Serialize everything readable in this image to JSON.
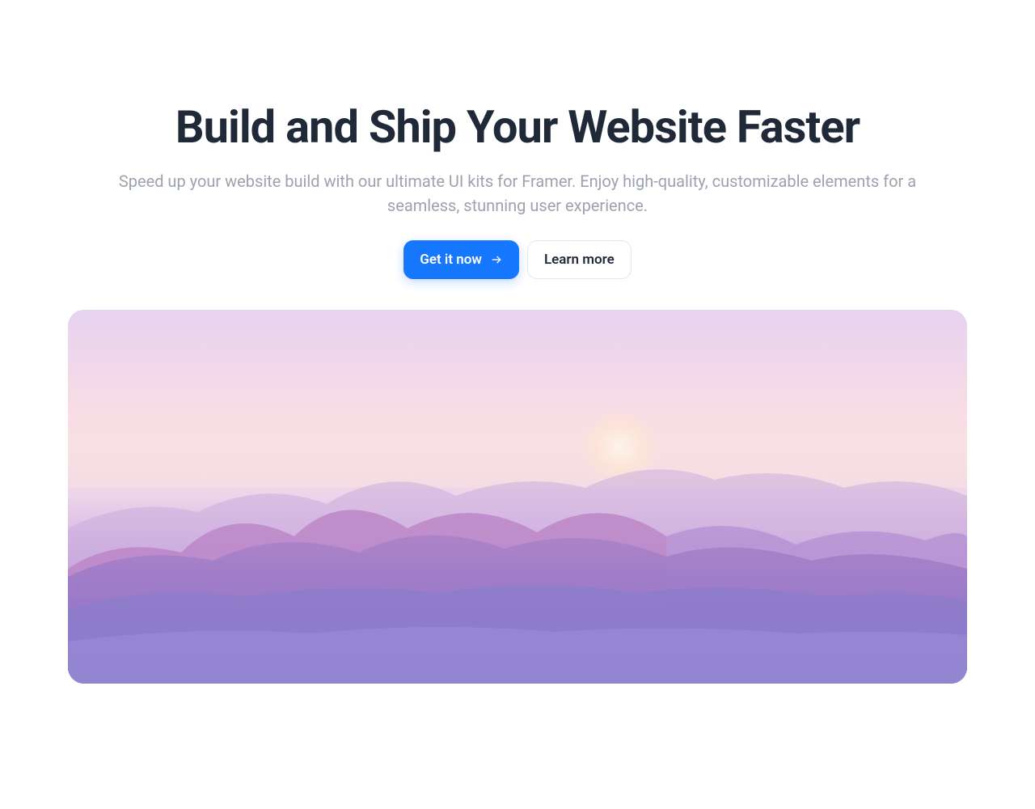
{
  "hero": {
    "title": "Build and Ship Your Website Faster",
    "subtitle": "Speed up your website build with our ultimate UI kits for Framer. Enjoy high-quality, customizable elements for a seamless, stunning user experience.",
    "primary_button_label": "Get it now",
    "secondary_button_label": "Learn more"
  }
}
